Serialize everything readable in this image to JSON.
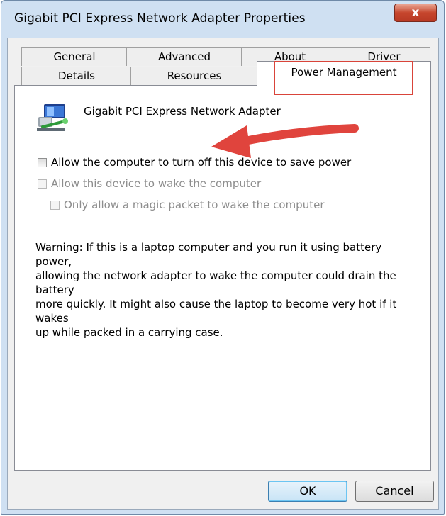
{
  "window": {
    "title": "Gigabit PCI Express Network Adapter Properties",
    "close_label": "x"
  },
  "tabs": {
    "row_back": [
      "General",
      "Advanced",
      "About",
      "Driver"
    ],
    "row_front": [
      "Details",
      "Resources",
      "Power Management"
    ],
    "active": "Power Management"
  },
  "device": {
    "name": "Gigabit PCI Express Network Adapter",
    "icon": "network-adapter-icon"
  },
  "options": [
    {
      "label": "Allow the computer to turn off this device to save power",
      "checked": false,
      "enabled": true
    },
    {
      "label": "Allow this device to wake the computer",
      "checked": false,
      "enabled": false
    },
    {
      "label": "Only allow a magic packet to wake the computer",
      "checked": false,
      "enabled": false
    }
  ],
  "warning": "Warning: If this is a laptop computer and you run it using battery power,\nallowing the network adapter to wake the computer could drain the battery\nmore quickly. It might also cause the laptop to become very hot if it wakes\nup while packed in a carrying case.",
  "buttons": {
    "ok": "OK",
    "cancel": "Cancel"
  },
  "annotations": {
    "highlight_color": "#d9443a",
    "arrow_color": "#e0443d"
  }
}
